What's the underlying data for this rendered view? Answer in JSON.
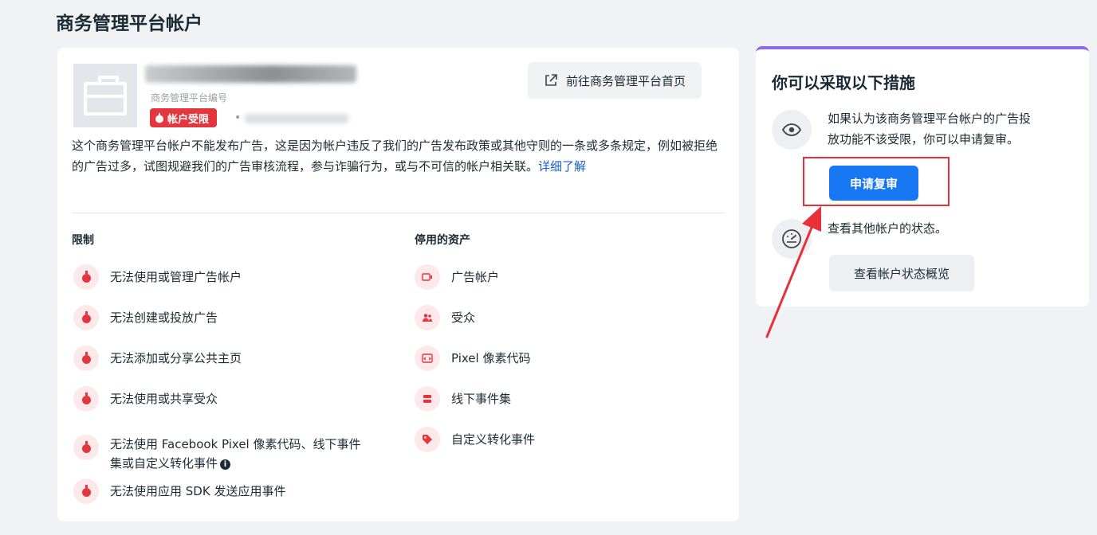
{
  "page": {
    "title": "商务管理平台帐户"
  },
  "account": {
    "id_label": "商务管理平台编号",
    "restricted_badge": "帐户受限",
    "home_button": "前往商务管理平台首页",
    "description": "这个商务管理平台帐户不能发布广告，这是因为帐户违反了我们的广告发布政策或其他守则的一条或多条规定，例如被拒绝的广告过多，试图规避我们的广告审核流程，参与诈骗行为，或与不可信的帐户相关联。",
    "learn_more": "详细了解"
  },
  "restrictions": {
    "title": "限制",
    "items": [
      {
        "text": "无法使用或管理广告帐户"
      },
      {
        "text": "无法创建或投放广告"
      },
      {
        "text": "无法添加或分享公共主页"
      },
      {
        "text": "无法使用或共享受众"
      },
      {
        "line1": "无法使用 Facebook Pixel 像素代码、线下事件",
        "line2": "集或自定义转化事件"
      },
      {
        "text": "无法使用应用 SDK 发送应用事件"
      }
    ]
  },
  "disabled_assets": {
    "title": "停用的资产",
    "items": [
      {
        "text": "广告帐户",
        "icon": "ad-account-icon"
      },
      {
        "text": "受众",
        "icon": "audience-icon"
      },
      {
        "text": "Pixel 像素代码",
        "icon": "pixel-code-icon"
      },
      {
        "text": "线下事件集",
        "icon": "offline-event-icon"
      },
      {
        "text": "自定义转化事件",
        "icon": "tag-icon"
      }
    ]
  },
  "actions": {
    "title": "你可以采取以下措施",
    "appeal_text_line1": "如果认为该商务管理平台帐户的广告投",
    "appeal_text_line2": "放功能不该受限，你可以申请复审。",
    "appeal_button": "申请复审",
    "status_text": "查看其他帐户的状态。",
    "status_button": "查看帐户状态概览"
  },
  "colors": {
    "primary": "#1877f2",
    "danger": "#e4363e",
    "accent_border": "#8a6ae8",
    "annotation": "#e8303a"
  }
}
